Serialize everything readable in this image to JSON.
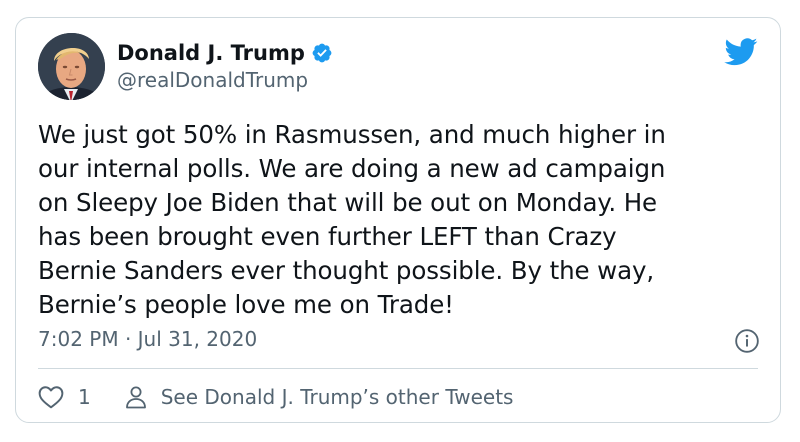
{
  "tweet": {
    "author": {
      "name": "Donald J. Trump",
      "handle": "@realDonaldTrump",
      "verified": true
    },
    "text_lines": [
      "We just got 50% in Rasmussen, and much higher in",
      "our internal polls. We are doing a new ad campaign",
      "on Sleepy Joe Biden that will be out on Monday. He",
      "has been brought even further LEFT than Crazy",
      "Bernie Sanders ever thought possible. By the way,",
      "Bernie’s people love me on Trade!"
    ],
    "timestamp": "7:02 PM · Jul 31, 2020",
    "likes": "1",
    "profile_link_label": "See Donald J. Trump’s other Tweets"
  },
  "icons": {
    "verified": "verified-badge-icon",
    "brand": "twitter-bird-icon",
    "info": "info-icon",
    "like": "heart-icon",
    "profile": "person-icon"
  },
  "colors": {
    "brand": "#1d9bf0",
    "text": "#0f1419",
    "secondary_text": "#536471",
    "border": "#cfd9de"
  }
}
